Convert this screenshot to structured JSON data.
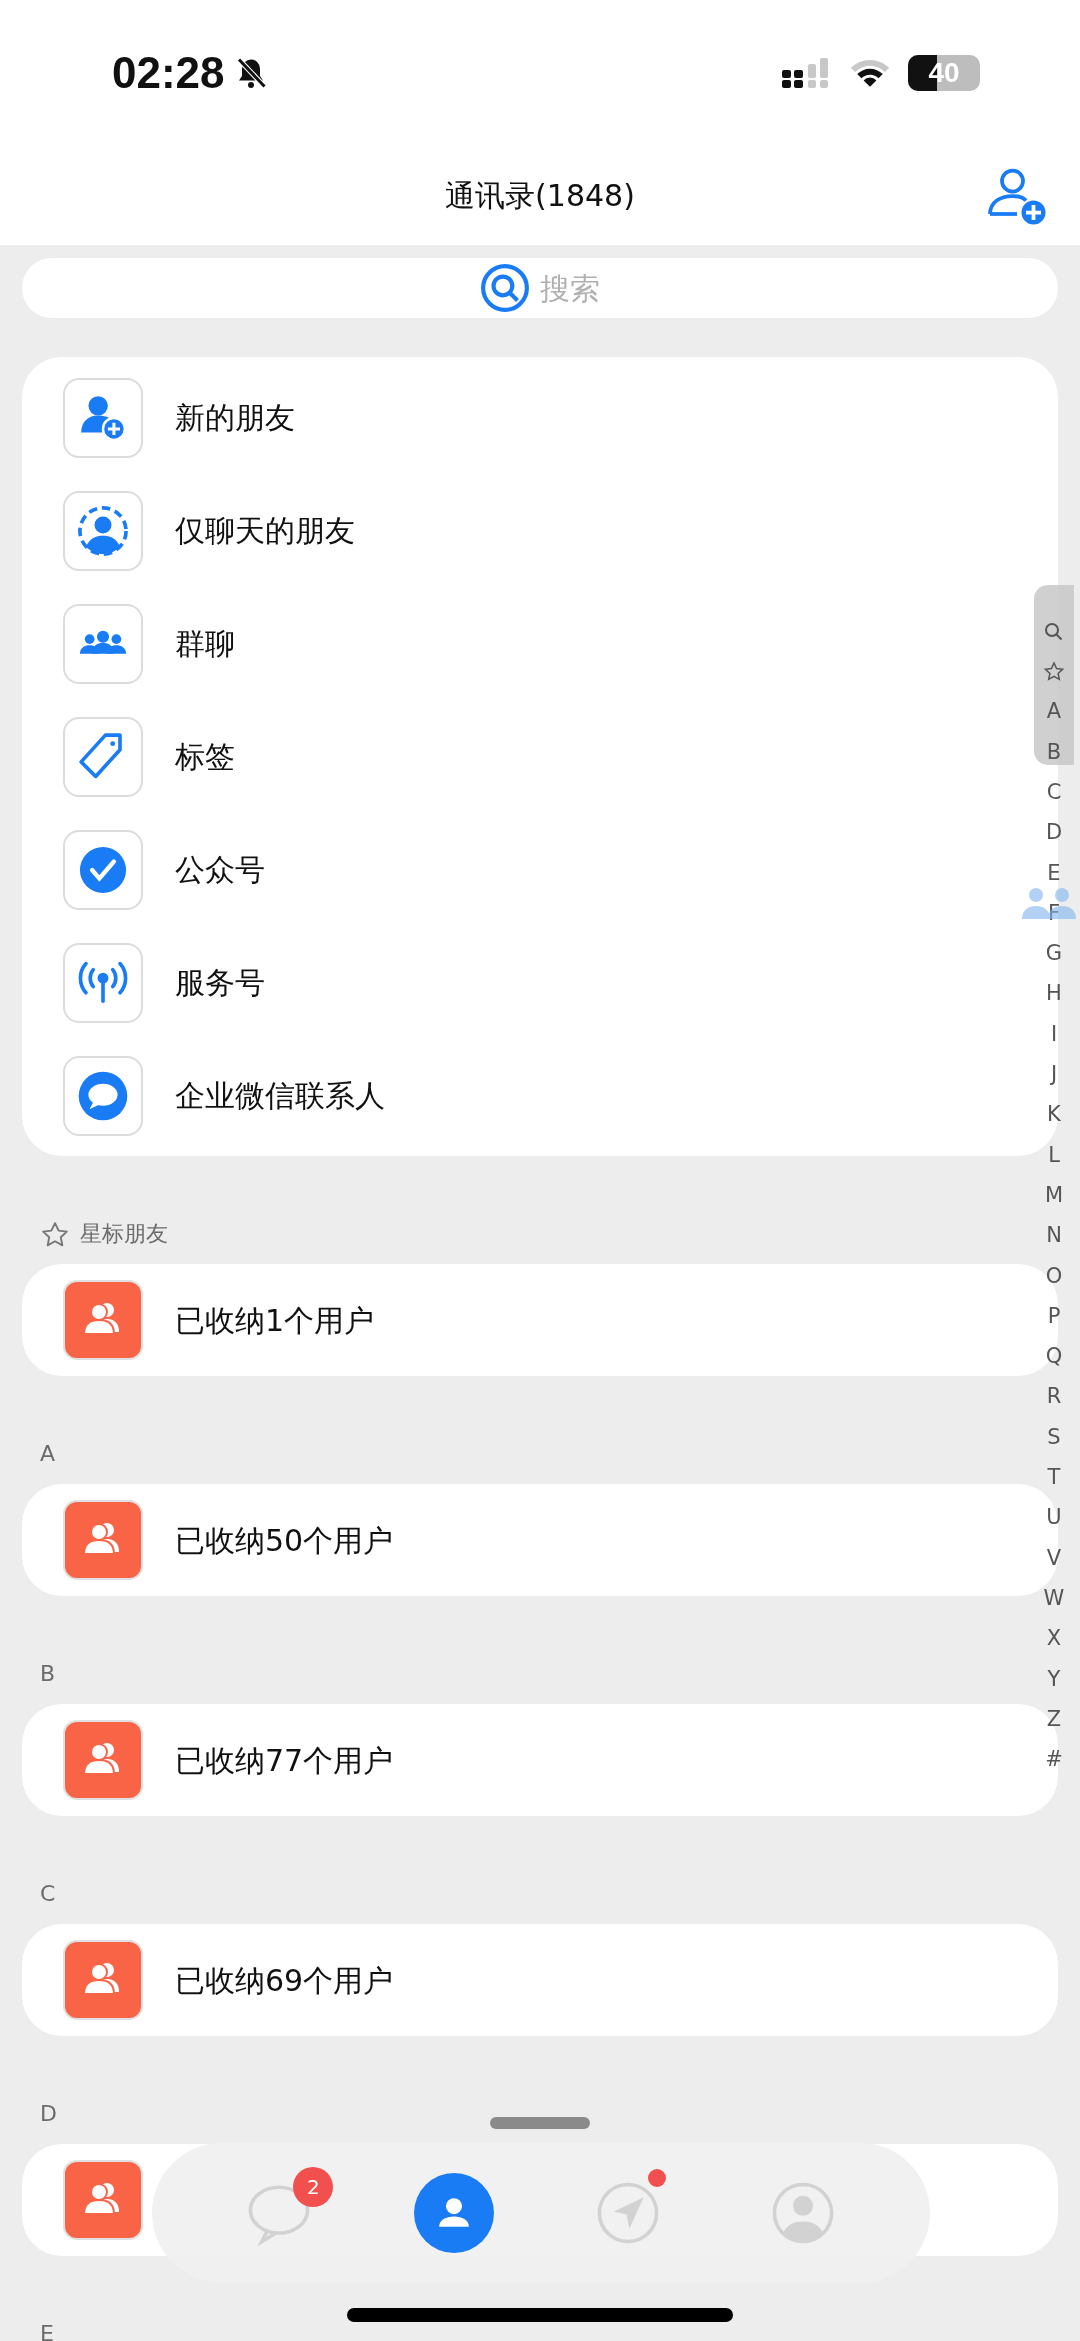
{
  "status_bar": {
    "time": "02:28",
    "battery": "40"
  },
  "header": {
    "title": "通讯录(1848)"
  },
  "search": {
    "placeholder": "搜索"
  },
  "menu": [
    {
      "kind": "new_friend",
      "label": "新的朋友"
    },
    {
      "kind": "chat_only",
      "label": "仅聊天的朋友"
    },
    {
      "kind": "group",
      "label": "群聊"
    },
    {
      "kind": "tag",
      "label": "标签"
    },
    {
      "kind": "official",
      "label": "公众号"
    },
    {
      "kind": "service",
      "label": "服务号"
    },
    {
      "kind": "wecom",
      "label": "企业微信联系人"
    }
  ],
  "sections": [
    {
      "header": "星标朋友",
      "starred": true,
      "label": "已收纳1个用户"
    },
    {
      "header": "A",
      "starred": false,
      "label": "已收纳50个用户"
    },
    {
      "header": "B",
      "starred": false,
      "label": "已收纳77个用户"
    },
    {
      "header": "C",
      "starred": false,
      "label": "已收纳69个用户"
    },
    {
      "header": "D",
      "starred": false
    }
  ],
  "next_header": "E",
  "index": [
    "A",
    "B",
    "C",
    "D",
    "E",
    "F",
    "G",
    "H",
    "I",
    "J",
    "K",
    "L",
    "M",
    "N",
    "O",
    "P",
    "Q",
    "R",
    "S",
    "T",
    "U",
    "V",
    "W",
    "X",
    "Y",
    "Z",
    "#"
  ],
  "tabs": [
    {
      "kind": "chats",
      "selected": false,
      "badge": "2",
      "dot": false
    },
    {
      "kind": "contacts",
      "selected": true,
      "dot": false
    },
    {
      "kind": "discover",
      "selected": false,
      "dot": true
    },
    {
      "kind": "me",
      "selected": false,
      "dot": false
    }
  ]
}
